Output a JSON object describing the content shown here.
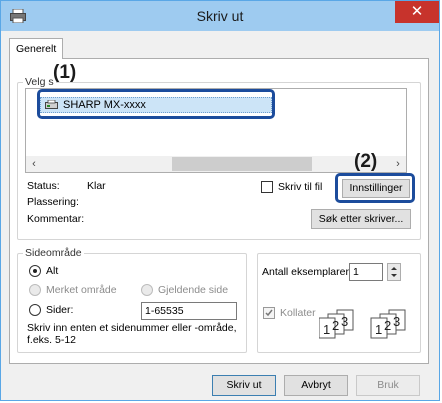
{
  "window": {
    "title": "Skriv ut",
    "close_glyph": "✕"
  },
  "tabs": [
    {
      "label": "Generelt"
    }
  ],
  "select_printer": {
    "legend": "Velg s",
    "callout_1": "(1)",
    "selected_printer": "SHARP MX-xxxx",
    "scroll_left": "‹",
    "scroll_right": "›"
  },
  "status": {
    "status_label": "Status:",
    "status_value": "Klar",
    "location_label": "Plassering:",
    "comment_label": "Kommentar:",
    "print_to_file_label": "Skriv til fil",
    "print_to_file_checked": false,
    "callout_2": "(2)",
    "settings_button": "Innstillinger",
    "find_printer_button": "Søk etter skriver..."
  },
  "page_range": {
    "legend": "Sideområde",
    "all_label": "Alt",
    "selection_label": "Merket område",
    "current_page_label": "Gjeldende side",
    "pages_label": "Sider:",
    "pages_value": "1-65535",
    "hint": "Skriv inn enten et sidenummer eller -område, f.eks. 5-12",
    "selected": "all"
  },
  "copies": {
    "count_label": "Antall eksemplarer:",
    "count_value": "1",
    "collate_label": "Kollater",
    "collate_checked": true,
    "collate_pages": [
      "1",
      "2",
      "3"
    ]
  },
  "footer": {
    "print_button": "Skriv ut",
    "cancel_button": "Avbryt",
    "apply_button": "Bruk"
  },
  "colors": {
    "title_bar": "#9ecbf0",
    "close_button": "#c7332c",
    "callout_border": "#1c4c9c",
    "selection": "#cce4f7"
  },
  "icons": [
    "printer-app-icon",
    "printer-icon",
    "close-icon",
    "spin-up-icon",
    "spin-down-icon",
    "collate-pages-icon"
  ]
}
